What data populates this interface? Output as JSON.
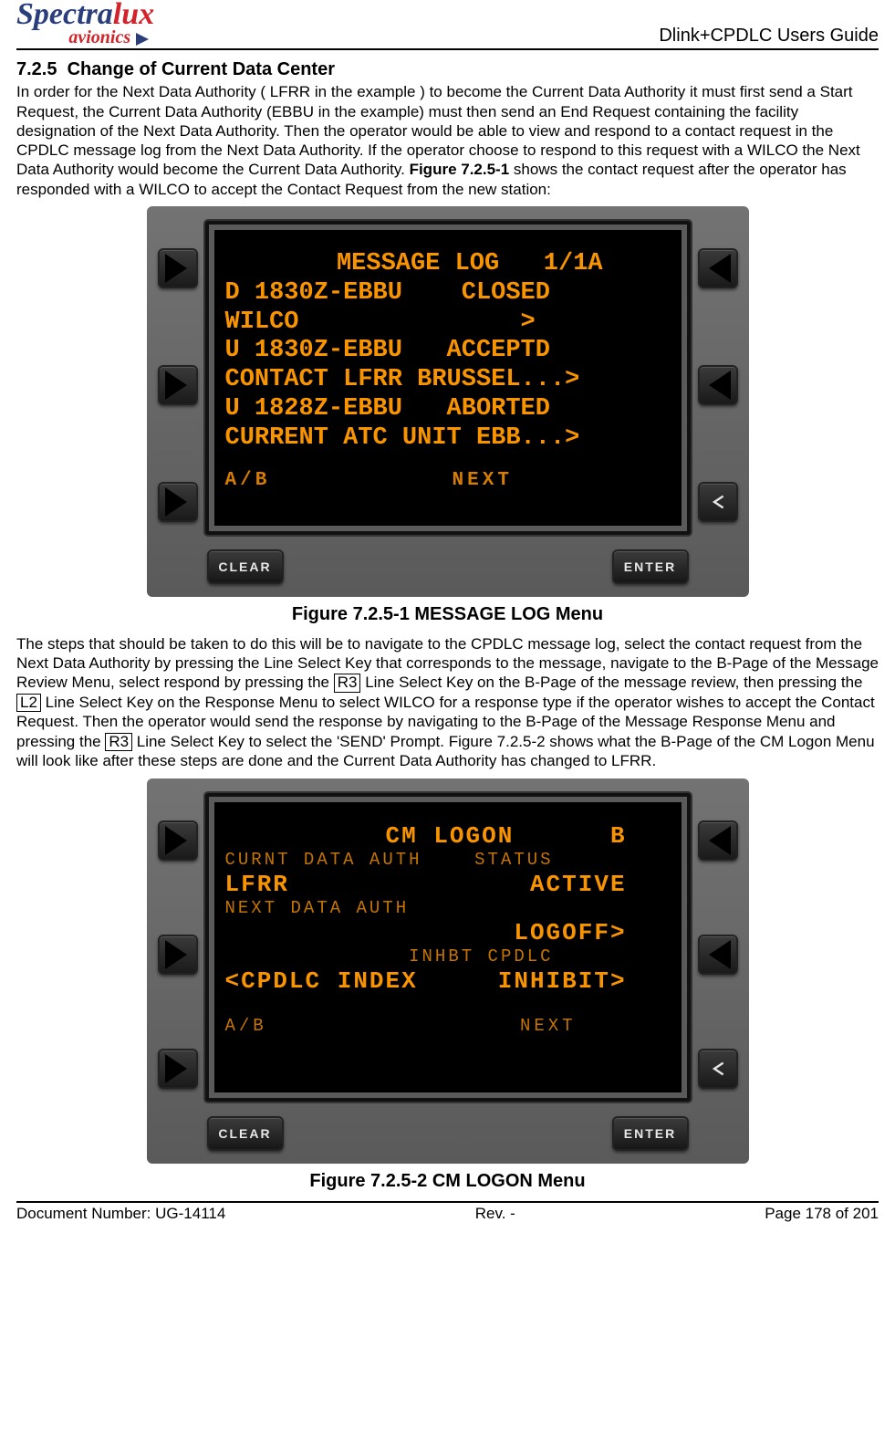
{
  "logo": {
    "line1_spectra": "Spectra",
    "line1_lux": "lux",
    "line2": "avionics"
  },
  "header": {
    "doc_title": "Dlink+CPDLC Users Guide"
  },
  "section": {
    "number": "7.2.5",
    "title": "Change of Current Data Center"
  },
  "para1_a": "In order for the Next Data Authority ( LFRR in the example )  to become the Current Data Authority it must first send a Start Request, the Current Data Authority (EBBU in the example) must then send an End Request containing the facility designation of the Next Data Authority.  Then the operator would be able to view and respond to a contact request in the CPDLC message log from the Next Data Authority.  If the operator choose to respond to this request with a WILCO the Next Data Authority would become the Current Data Authority.  ",
  "para1_bold": "Figure 7.2.5-1",
  "para1_b": " shows the contact request after the operator has responded with a WILCO to accept the Contact Request from the new station:",
  "screen1": {
    "title": "   MESSAGE LOG   1/1A",
    "lines": [
      "D 1830Z-EBBU    CLOSED",
      "WILCO               >",
      "U 1830Z-EBBU   ACCEPTD",
      "CONTACT LFRR BRUSSEL...>",
      "U 1828Z-EBBU   ABORTED",
      "CURRENT ATC UNIT EBB...>"
    ],
    "footer": "A/B            NEXT"
  },
  "caption1": "Figure 7.2.5-1 MESSAGE LOG Menu",
  "para2_a": "The steps that should be taken to do this will be to navigate to the CPDLC message log, select the contact request from the Next Data Authority by pressing the Line Select Key that corresponds to the message, navigate to the B-Page of the Message Review Menu, select respond by pressing the ",
  "para2_k1": "R3",
  "para2_b": " Line Select Key on the B-Page of the message review, then pressing the ",
  "para2_k2": "L2",
  "para2_c": " Line Select Key on the Response Menu to select WILCO for a response type if the operator wishes to accept the Contact Request.  Then the operator would send the response by navigating to the B-Page of the Message Response Menu and pressing the ",
  "para2_k3": "R3",
  "para2_d": " Line Select Key to select the 'SEND' Prompt. Figure 7.2.5-2 shows what the B-Page of the CM Logon Menu will look like after these steps are done and the Current Data Authority has changed to LFRR.",
  "screen2": {
    "title_left": "          CM LOGON      B",
    "rows": [
      {
        "small": "CURNT DATA AUTH    STATUS",
        "big": "LFRR               ACTIVE"
      },
      {
        "small": "NEXT DATA AUTH           ",
        "big": "                  LOGOFF>"
      },
      {
        "small": "              INHBT CPDLC",
        "big": "<CPDLC INDEX     INHIBIT>"
      }
    ],
    "footer": "A/B                  NEXT"
  },
  "caption2": "Figure 7.2.5-2 CM LOGON Menu",
  "buttons": {
    "clear": "CLEAR",
    "enter": "ENTER"
  },
  "footer": {
    "left_label": "Document Number:  ",
    "left_value": "UG-14114",
    "center": "Rev. -",
    "right": "Page 178 of 201"
  },
  "chart_data": null
}
